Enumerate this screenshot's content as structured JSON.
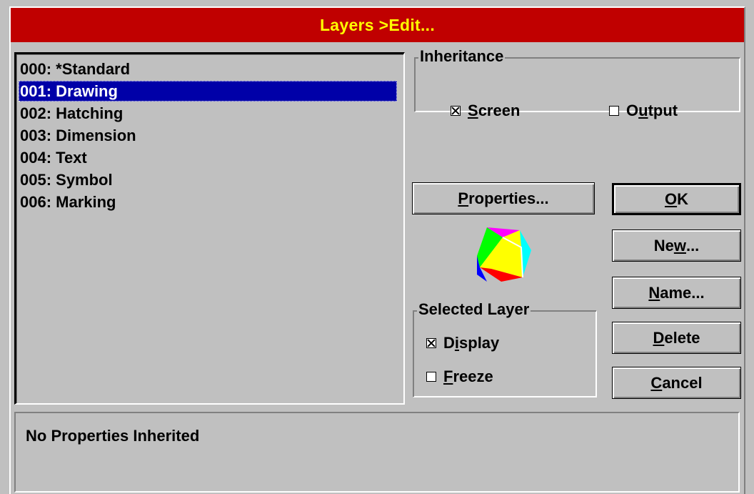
{
  "window": {
    "title": "Layers >Edit..."
  },
  "layers": {
    "items": [
      {
        "label": "000: *Standard"
      },
      {
        "label": "001: Drawing"
      },
      {
        "label": "002: Hatching"
      },
      {
        "label": "003: Dimension"
      },
      {
        "label": "004: Text"
      },
      {
        "label": "005: Symbol"
      },
      {
        "label": "006: Marking"
      }
    ],
    "selected_index": 1
  },
  "inheritance": {
    "title": "Inheritance",
    "screen": {
      "label_pre": "",
      "label_key": "S",
      "label_post": "creen",
      "checked": true
    },
    "output": {
      "label_pre": "O",
      "label_key": "u",
      "label_post": "tput",
      "checked": false
    }
  },
  "selected_layer": {
    "title": "Selected Layer",
    "display": {
      "label_pre": "D",
      "label_key": "i",
      "label_post": "splay",
      "checked": true
    },
    "freeze": {
      "label_pre": "",
      "label_key": "F",
      "label_post": "reeze",
      "checked": false
    }
  },
  "buttons": {
    "properties": {
      "pre": "",
      "key": "P",
      "post": "roperties..."
    },
    "ok": {
      "pre": "",
      "key": "O",
      "post": "K"
    },
    "new": {
      "pre": "Ne",
      "key": "w",
      "post": "..."
    },
    "name": {
      "pre": "",
      "key": "N",
      "post": "ame..."
    },
    "delete": {
      "pre": "",
      "key": "D",
      "post": "elete"
    },
    "cancel": {
      "pre": "",
      "key": "C",
      "post": "ancel"
    }
  },
  "layer_icon": {
    "icon": "cube-icon",
    "colors": [
      "#ff00ff",
      "#00ffff",
      "#ffff00",
      "#00ff00",
      "#ff0000",
      "#0000ff",
      "#ffffff"
    ]
  },
  "status": {
    "text": "No Properties Inherited"
  },
  "colors": {
    "title_bg": "#c00000",
    "title_text": "#ffff00",
    "selection": "#0000a8",
    "face": "#c0c0c0"
  }
}
